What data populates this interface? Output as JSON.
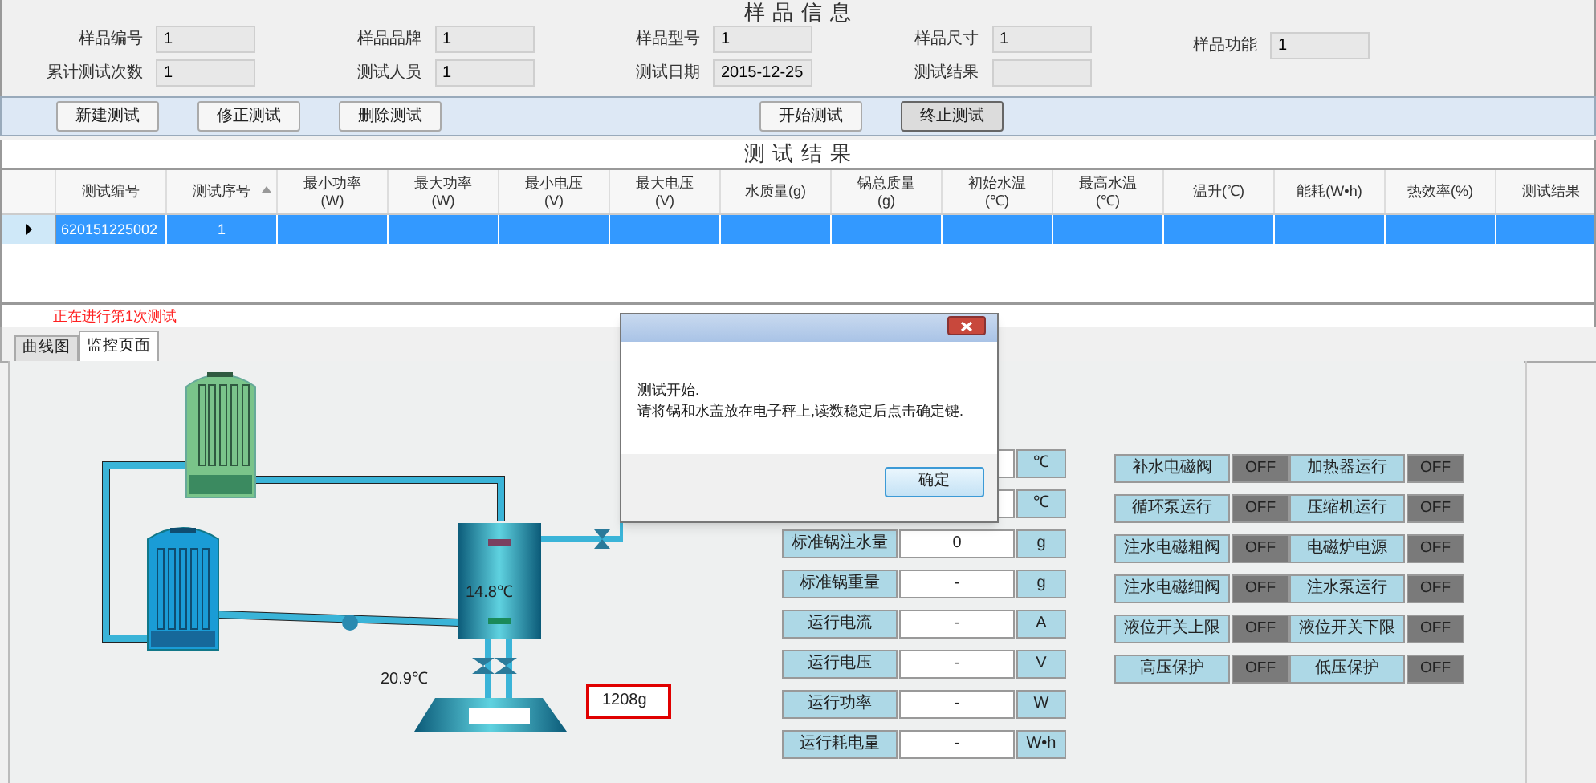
{
  "sample_info": {
    "title": "样 品 信 息",
    "fields": [
      {
        "label": "样品编号",
        "value": "1"
      },
      {
        "label": "样品品牌",
        "value": "1"
      },
      {
        "label": "样品型号",
        "value": "1"
      },
      {
        "label": "样品尺寸",
        "value": "1"
      },
      {
        "label": "累计测试次数",
        "value": "1"
      },
      {
        "label": "测试人员",
        "value": "1"
      },
      {
        "label": "测试日期",
        "value": "2015-12-25"
      },
      {
        "label": "测试结果"
      }
    ],
    "extra_field": {
      "label": "样品功能",
      "value": "1"
    }
  },
  "toolbar": {
    "buttons": [
      {
        "label": "新建测试",
        "focused": false
      },
      {
        "label": "修正测试",
        "focused": false
      },
      {
        "label": "删除测试",
        "focused": false
      },
      {
        "label": "开始测试",
        "focused": false
      },
      {
        "label": "终止测试",
        "focused": true
      }
    ]
  },
  "results": {
    "title": "测 试 结 果",
    "columns": [
      {
        "label": "测试编号",
        "sorted": false
      },
      {
        "label": "测试序号",
        "sorted": true
      },
      {
        "label": "最小功率",
        "unit": "(W)",
        "sorted": false
      },
      {
        "label": "最大功率",
        "unit": "(W)",
        "sorted": false
      },
      {
        "label": "最小电压",
        "unit": "(V)",
        "sorted": false
      },
      {
        "label": "最大电压",
        "unit": "(V)",
        "sorted": false
      },
      {
        "label": "水质量(g)",
        "sorted": false
      },
      {
        "label": "锅总质量",
        "unit": "(g)",
        "sorted": false
      },
      {
        "label": "初始水温",
        "unit": "(℃)",
        "sorted": false
      },
      {
        "label": "最高水温",
        "unit": "(℃)",
        "sorted": false
      },
      {
        "label": "温升(℃)",
        "sorted": false
      },
      {
        "label": "能耗(W•h)",
        "sorted": false
      },
      {
        "label": "热效率(%)",
        "sorted": false
      },
      {
        "label": "测试结果",
        "sorted": false
      }
    ],
    "rows": [
      {
        "selected": true,
        "cells": [
          "620151225002",
          "1",
          "",
          "",
          "",
          "",
          "",
          "",
          "",
          "",
          "",
          "",
          "",
          ""
        ]
      }
    ]
  },
  "status_text": "正在进行第1次测试",
  "tabs": [
    {
      "label": "曲线图",
      "selected": false
    },
    {
      "label": "监控页面",
      "selected": true
    }
  ],
  "monitor": {
    "tank_temp": "14.8℃",
    "water_temp": "20.9℃",
    "scale_reading": "1208g",
    "params": [
      {
        "unit": "℃"
      },
      {
        "unit": "℃"
      },
      {
        "label": "标准锅注水量",
        "value": "0",
        "unit": "g"
      },
      {
        "label": "标准锅重量",
        "value": "-",
        "unit": "g"
      },
      {
        "label": "运行电流",
        "value": "-",
        "unit": "A"
      },
      {
        "label": "运行电压",
        "value": "-",
        "unit": "V"
      },
      {
        "label": "运行功率",
        "value": "-",
        "unit": "W"
      },
      {
        "label": "运行耗电量",
        "value": "-",
        "unit": "W•h"
      }
    ],
    "switches": [
      {
        "label": "补水电磁阀",
        "state": "OFF",
        "on": false
      },
      {
        "label": "加热器运行",
        "state": "OFF",
        "on": false
      },
      {
        "label": "循环泵运行",
        "state": "OFF",
        "on": false
      },
      {
        "label": "压缩机运行",
        "state": "OFF",
        "on": false
      },
      {
        "label": "注水电磁粗阀",
        "state": "OFF",
        "on": false
      },
      {
        "label": "电磁炉电源",
        "state": "OFF",
        "on": false
      },
      {
        "label": "注水电磁细阀",
        "state": "OFF",
        "on": false
      },
      {
        "label": "注水泵运行",
        "state": "OFF",
        "on": false
      },
      {
        "label": "液位开关上限",
        "state": "OFF",
        "on": false
      },
      {
        "label": "液位开关下限",
        "state": "OFF",
        "on": false
      },
      {
        "label": "高压保护",
        "state": "OFF",
        "on": false
      },
      {
        "label": "低压保护",
        "state": "OFF",
        "on": false
      }
    ]
  },
  "dialog": {
    "lines": [
      "测试开始.",
      "请将锅和水盖放在电子秤上,读数稳定后点击确定键."
    ],
    "ok_button": "确定"
  }
}
